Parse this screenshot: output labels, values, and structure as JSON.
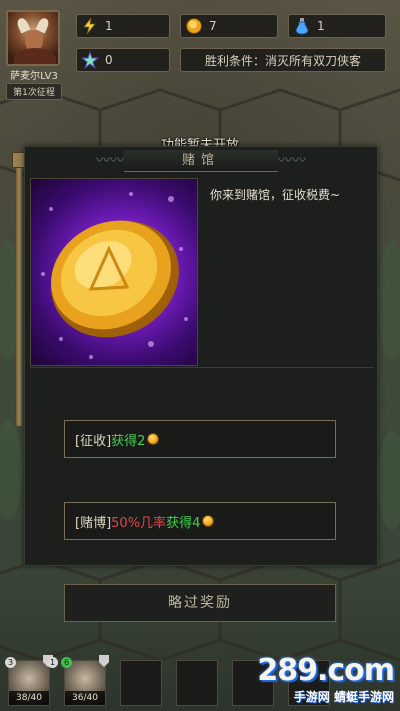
{
  "hud": {
    "hero_name": "萨麦尔LV3",
    "hero_sub": "第1次征程",
    "energy": "1",
    "coins": "7",
    "potions": "1",
    "gems": "0",
    "victory_condition": "胜利条件：消灭所有双刀侠客"
  },
  "event": {
    "notice": "功能暂未开放",
    "title": "赌馆",
    "description": "你来到赌馆，征收税费~",
    "option1": {
      "tag": "[征收]",
      "reward_label": "获得2"
    },
    "option2": {
      "tag": "[赌博]",
      "chance_label": "50%几率",
      "reward_label": "获得4"
    },
    "skip_label": "略过奖励"
  },
  "units": [
    {
      "level": "3",
      "shield": true,
      "hp": "38/40",
      "filled": true
    },
    {
      "level": "1",
      "level2": "6",
      "shield": true,
      "hp": "36/40",
      "filled": true
    },
    {
      "hp": "",
      "filled": false
    },
    {
      "hp": "",
      "filled": false
    },
    {
      "hp": "",
      "filled": false
    },
    {
      "hp": "",
      "filled": false
    }
  ],
  "watermark": {
    "main": "289.com",
    "sub": "手游网",
    "sub2": "蜻蜓手游网"
  },
  "colors": {
    "reward_green": "#3fd24f",
    "chance_red": "#e24848",
    "coin_gold": "#f0a418"
  }
}
